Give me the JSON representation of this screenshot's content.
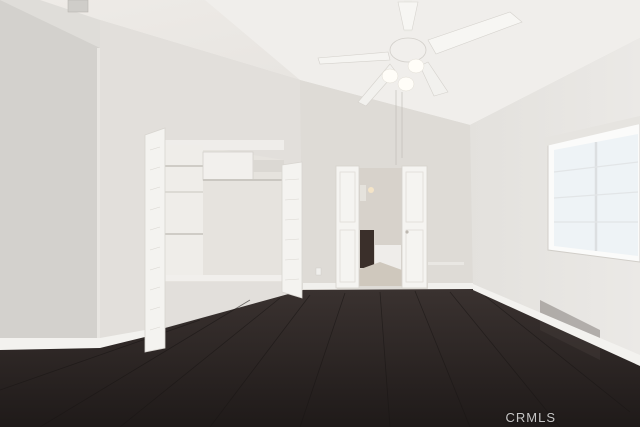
{
  "photo": {
    "scene": "vacant-bedroom-interior",
    "colors": {
      "wall": "#e4e2de",
      "wall_shadow": "#cfccc7",
      "ceiling": "#f0eeeb",
      "floor": "#2b2523",
      "trim": "#f5f5f2",
      "window_glass": "#eef3f6"
    }
  },
  "watermark": {
    "text": "CRMLS"
  }
}
